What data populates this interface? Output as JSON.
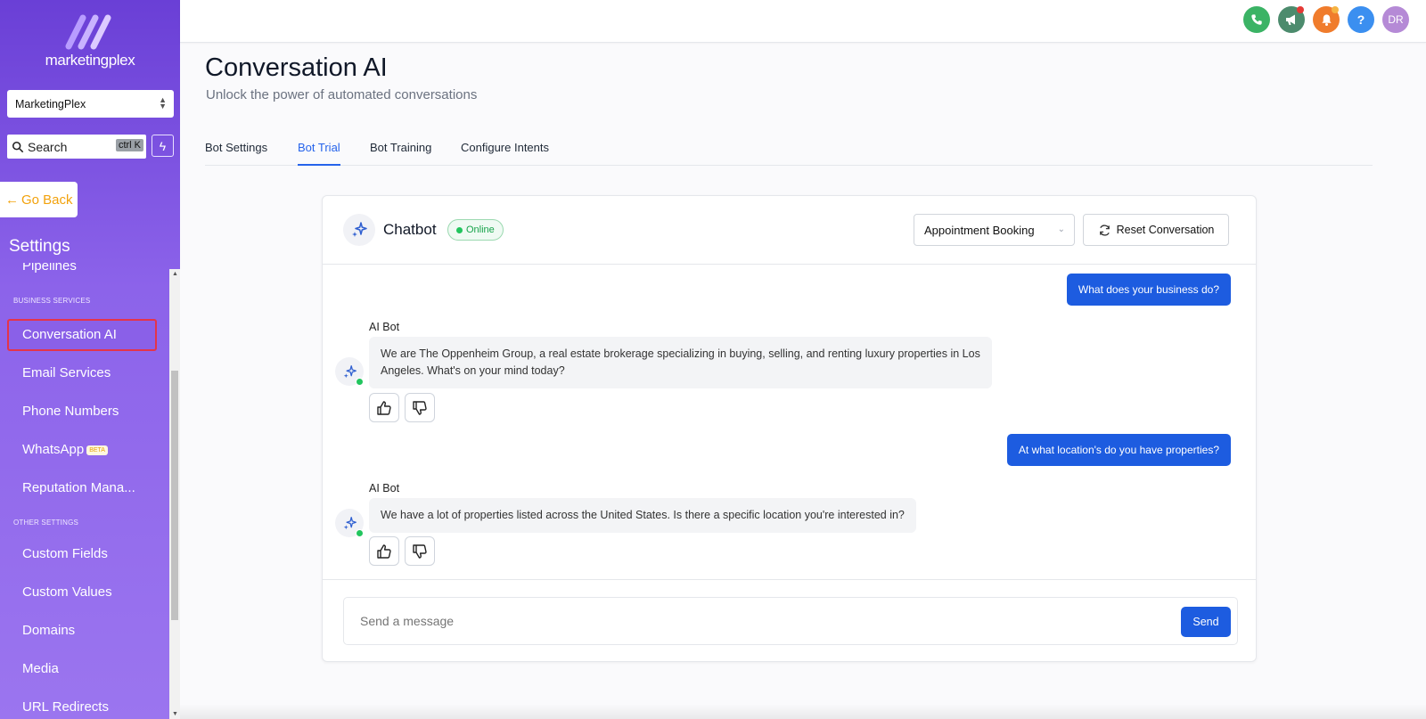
{
  "brand": {
    "logo_text": "marketingplex"
  },
  "sidebar": {
    "account": "MarketingPlex",
    "search": {
      "placeholder": "Search",
      "shortcut": "ctrl K"
    },
    "go_back": "Go Back",
    "settings_title": "Settings",
    "items": {
      "pipelines": "Pipelines",
      "section_business": "BUSINESS SERVICES",
      "conversation_ai": "Conversation AI",
      "email_services": "Email Services",
      "phone_numbers": "Phone Numbers",
      "whatsapp": "WhatsApp",
      "whatsapp_badge": "BETA",
      "reputation": "Reputation Mana...",
      "section_other": "OTHER SETTINGS",
      "custom_fields": "Custom Fields",
      "custom_values": "Custom Values",
      "domains": "Domains",
      "media": "Media",
      "url_redirects": "URL Redirects"
    }
  },
  "topbar": {
    "icons": [
      "phone-icon",
      "megaphone-icon",
      "bell-icon",
      "help-icon"
    ],
    "help_glyph": "?",
    "avatar_initials": "DR",
    "colors": {
      "phone": "#3bb365",
      "megaphone": "#4c8b6d",
      "bell": "#f07c2c",
      "help": "#3b8ff0",
      "avatar": "#b58ad6",
      "notification_dot": "#e53935"
    }
  },
  "page": {
    "title": "Conversation AI",
    "subtitle": "Unlock the power of automated conversations",
    "tabs": [
      "Bot Settings",
      "Bot Trial",
      "Bot Training",
      "Configure Intents"
    ],
    "active_tab": "Bot Trial"
  },
  "chat": {
    "bot_name": "Chatbot",
    "status": "Online",
    "flow_select": "Appointment Booking",
    "reset_label": "Reset Conversation",
    "messages": [
      {
        "from": "user",
        "text": "What does your business do?"
      },
      {
        "from": "bot",
        "sender": "AI Bot",
        "text": "We are The Oppenheim Group, a real estate brokerage specializing in buying, selling, and renting luxury properties in Los Angeles. What's on your mind today?"
      },
      {
        "from": "user",
        "text": "At what location's do you have properties?"
      },
      {
        "from": "bot",
        "sender": "AI Bot",
        "text": "We have a lot of properties listed across the United States. Is there a specific location you're interested in?"
      }
    ],
    "composer_placeholder": "Send a message",
    "send_label": "Send"
  },
  "colors": {
    "accent": "#2563eb",
    "sidebar": "#7b4fe0",
    "active_border": "#e4344a",
    "go_back_text": "#f2a20c"
  }
}
